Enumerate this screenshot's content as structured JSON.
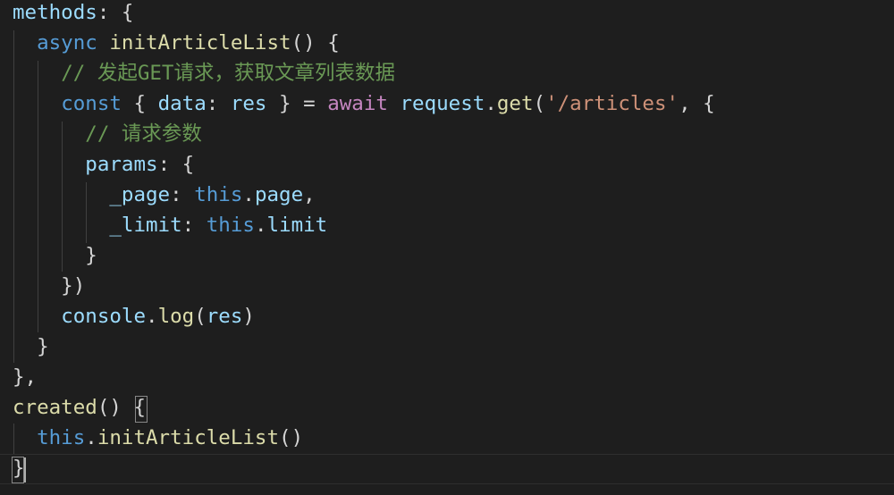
{
  "editor": {
    "language": "javascript",
    "theme": "dark",
    "lines": [
      {
        "tokens": [
          {
            "t": "methods",
            "c": "var"
          },
          {
            "t": ": {",
            "c": "p"
          }
        ]
      },
      {
        "tokens": [
          {
            "t": "  ",
            "c": "p"
          },
          {
            "t": "async",
            "c": "kw"
          },
          {
            "t": " ",
            "c": "p"
          },
          {
            "t": "initArticleList",
            "c": "fn"
          },
          {
            "t": "() {",
            "c": "p"
          }
        ]
      },
      {
        "tokens": [
          {
            "t": "    ",
            "c": "p"
          },
          {
            "t": "// 发起GET请求，获取文章列表数据",
            "c": "cm"
          }
        ]
      },
      {
        "tokens": [
          {
            "t": "    ",
            "c": "p"
          },
          {
            "t": "const",
            "c": "kw"
          },
          {
            "t": " { ",
            "c": "p"
          },
          {
            "t": "data",
            "c": "var"
          },
          {
            "t": ": ",
            "c": "p"
          },
          {
            "t": "res",
            "c": "var"
          },
          {
            "t": " } = ",
            "c": "p"
          },
          {
            "t": "await",
            "c": "ctl"
          },
          {
            "t": " ",
            "c": "p"
          },
          {
            "t": "request",
            "c": "var"
          },
          {
            "t": ".",
            "c": "p"
          },
          {
            "t": "get",
            "c": "fn"
          },
          {
            "t": "(",
            "c": "p"
          },
          {
            "t": "'/articles'",
            "c": "str"
          },
          {
            "t": ", {",
            "c": "p"
          }
        ]
      },
      {
        "tokens": [
          {
            "t": "      ",
            "c": "p"
          },
          {
            "t": "// 请求参数",
            "c": "cm"
          }
        ]
      },
      {
        "tokens": [
          {
            "t": "      ",
            "c": "p"
          },
          {
            "t": "params",
            "c": "var"
          },
          {
            "t": ": {",
            "c": "p"
          }
        ]
      },
      {
        "tokens": [
          {
            "t": "        ",
            "c": "p"
          },
          {
            "t": "_page",
            "c": "var"
          },
          {
            "t": ": ",
            "c": "p"
          },
          {
            "t": "this",
            "c": "kw"
          },
          {
            "t": ".",
            "c": "p"
          },
          {
            "t": "page",
            "c": "var"
          },
          {
            "t": ",",
            "c": "p"
          }
        ]
      },
      {
        "tokens": [
          {
            "t": "        ",
            "c": "p"
          },
          {
            "t": "_limit",
            "c": "var"
          },
          {
            "t": ": ",
            "c": "p"
          },
          {
            "t": "this",
            "c": "kw"
          },
          {
            "t": ".",
            "c": "p"
          },
          {
            "t": "limit",
            "c": "var"
          }
        ]
      },
      {
        "tokens": [
          {
            "t": "      }",
            "c": "p"
          }
        ]
      },
      {
        "tokens": [
          {
            "t": "    })",
            "c": "p"
          }
        ]
      },
      {
        "tokens": [
          {
            "t": "    ",
            "c": "p"
          },
          {
            "t": "console",
            "c": "var"
          },
          {
            "t": ".",
            "c": "p"
          },
          {
            "t": "log",
            "c": "fn"
          },
          {
            "t": "(",
            "c": "p"
          },
          {
            "t": "res",
            "c": "var"
          },
          {
            "t": ")",
            "c": "p"
          }
        ]
      },
      {
        "tokens": [
          {
            "t": "  }",
            "c": "p"
          }
        ]
      },
      {
        "tokens": [
          {
            "t": "},",
            "c": "p"
          }
        ]
      },
      {
        "tokens": [
          {
            "t": "created",
            "c": "fn"
          },
          {
            "t": "() {",
            "c": "p"
          }
        ]
      },
      {
        "tokens": [
          {
            "t": "  ",
            "c": "p"
          },
          {
            "t": "this",
            "c": "kw"
          },
          {
            "t": ".",
            "c": "p"
          },
          {
            "t": "initArticleList",
            "c": "fn"
          },
          {
            "t": "()",
            "c": "p"
          }
        ]
      },
      {
        "tokens": [
          {
            "t": "}",
            "c": "p"
          }
        ]
      }
    ]
  }
}
